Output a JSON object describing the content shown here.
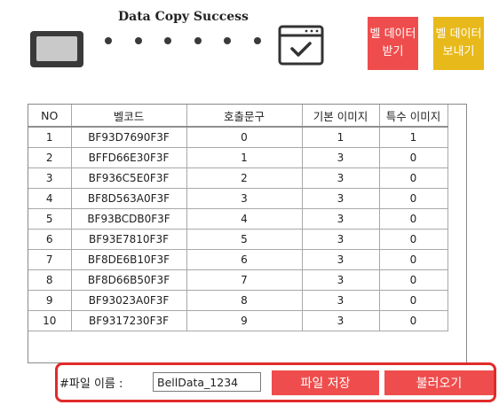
{
  "status": {
    "title": "Data Copy Success",
    "dot_count": 6
  },
  "buttons": {
    "receive": "벨 데이터\n받기",
    "send": "벨 데이터\n보내기"
  },
  "table": {
    "headers": [
      "NO",
      "벨코드",
      "호출문구",
      "기본 이미지",
      "특수 이미지"
    ],
    "rows": [
      [
        "1",
        "BF93D7690F3F",
        "0",
        "1",
        "1"
      ],
      [
        "2",
        "BFFD66E30F3F",
        "1",
        "3",
        "0"
      ],
      [
        "3",
        "BF936C5E0F3F",
        "2",
        "3",
        "0"
      ],
      [
        "4",
        "BF8D563A0F3F",
        "3",
        "3",
        "0"
      ],
      [
        "5",
        "BF93BCDB0F3F",
        "4",
        "3",
        "0"
      ],
      [
        "6",
        "BF93E7810F3F",
        "5",
        "3",
        "0"
      ],
      [
        "7",
        "BF8DE6B10F3F",
        "6",
        "3",
        "0"
      ],
      [
        "8",
        "BF8D66B50F3F",
        "7",
        "3",
        "0"
      ],
      [
        "9",
        "BF93023A0F3F",
        "8",
        "3",
        "0"
      ],
      [
        "10",
        "BF9317230F3F",
        "9",
        "3",
        "0"
      ]
    ]
  },
  "footer": {
    "file_label": "#파일 이름 :",
    "file_value": "BellData_1234",
    "save_label": "파일 저장",
    "load_label": "불러오기"
  },
  "colors": {
    "red": "#ef4d4d",
    "yellow": "#e8b91a",
    "highlight": "#e12a2a"
  }
}
